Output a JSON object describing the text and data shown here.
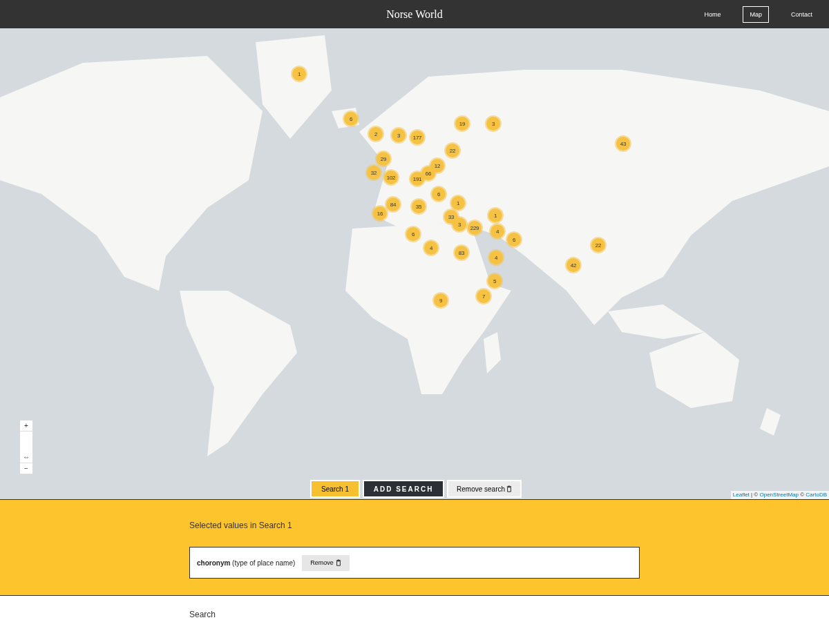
{
  "header": {
    "title": "Norse World",
    "nav": [
      {
        "label": "Home",
        "selected": false
      },
      {
        "label": "Map",
        "selected": true
      },
      {
        "label": "Contact",
        "selected": false
      }
    ]
  },
  "map": {
    "zoom_controls": [
      "+",
      "⇔",
      "−"
    ],
    "markers": [
      "1",
      "6",
      "2",
      "3",
      "177",
      "19",
      "3",
      "43",
      "22",
      "29",
      "12",
      "32",
      "102",
      "191",
      "66",
      "6",
      "84",
      "35",
      "1",
      "16",
      "1",
      "33",
      "3",
      "229",
      "4",
      "6",
      "6",
      "4",
      "83",
      "22",
      "4",
      "42",
      "5",
      "7",
      "9"
    ],
    "search_tabs": [
      {
        "label": "Search 1",
        "selected": true
      }
    ],
    "add_search": "ADD SEARCH",
    "remove_search": "Remove search",
    "attribution": [
      {
        "text": "Leaflet",
        "kind": "link"
      },
      {
        "text": " | © ",
        "kind": "text"
      },
      {
        "text": "OpenStreetMap",
        "kind": "link"
      },
      {
        "text": " © ",
        "kind": "text"
      },
      {
        "text": "CartoDB",
        "kind": "link"
      }
    ]
  },
  "selected": {
    "heading": "Selected values in Search 1",
    "values": [
      {
        "name": "choronym",
        "description": "(type of place name)",
        "remove": "Remove"
      }
    ]
  },
  "search": {
    "heading": "Search"
  }
}
